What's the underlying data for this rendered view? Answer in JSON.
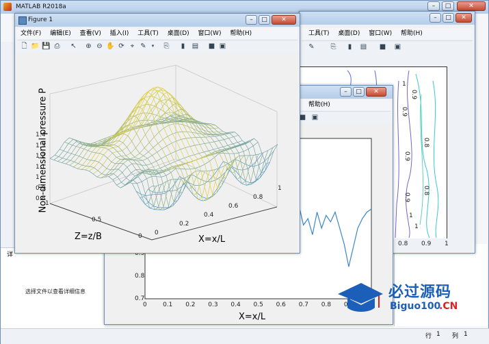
{
  "main_window": {
    "title": "MATLAB R2018a",
    "menu": [
      "文件(F)",
      "编辑(E)",
      "查看(V)",
      "插入(I)",
      "工具(T)",
      "桌面(D)",
      "窗口(W)",
      "帮助(H)"
    ],
    "detail_label": "详",
    "detail_text": "选择文件以查看详细信息",
    "status": {
      "row_label": "行",
      "row_value": "1",
      "col_label": "列",
      "col_value": "1"
    }
  },
  "figure1": {
    "title": "Figure 1",
    "menu": [
      "文件(F)",
      "编辑(E)",
      "查看(V)",
      "插入(I)",
      "工具(T)",
      "桌面(D)",
      "窗口(W)",
      "帮助(H)"
    ],
    "zlabel": "Non-dimensional pressure P",
    "xlabel": "X=x/L",
    "ylabel": "Z=z/B",
    "z_ticks": [
      "1.4",
      "1.3",
      "1.2",
      "1.1",
      "1",
      "0.9",
      "0.8"
    ],
    "x_ticks": [
      "0",
      "0.2",
      "0.4",
      "0.6",
      "0.8",
      "1"
    ],
    "y_ticks": [
      "0",
      "0.5",
      "1"
    ]
  },
  "figure2": {
    "help_menu": "帮助(H)",
    "xlabel": "X=x/L",
    "x_ticks": [
      "0",
      "0.1",
      "0.2",
      "0.3",
      "0.4",
      "0.5",
      "0.6",
      "0.7",
      "0.8",
      "0.9",
      "1"
    ],
    "y_ticks": [
      "0.9",
      "0.8",
      "0.7"
    ]
  },
  "figure3": {
    "menu": [
      "工具(T)",
      "桌面(D)",
      "窗口(W)",
      "帮助(H)"
    ],
    "contour_labels": [
      "1",
      "1",
      "0.9",
      "0.9",
      "0.8",
      "0.9",
      "0.8",
      "0.9",
      "1",
      "1"
    ],
    "x_ticks": [
      "0.8",
      "0.9",
      "1"
    ]
  },
  "watermark": {
    "chinese": "必过源码",
    "latin": "Biguo100",
    "suffix": ".CN"
  },
  "colors": {
    "accent": "#4f94c9",
    "surface_yellow": "#e6d23a",
    "surface_green": "#4fc6a0",
    "surface_blue": "#3d8ed6"
  },
  "chart_data": {
    "type": "line",
    "xlabel": "X=x/L",
    "xlim": [
      0,
      1
    ],
    "ylim": [
      0.7,
      1.2
    ],
    "series": [
      {
        "x": [
          0.6,
          0.62,
          0.64,
          0.66,
          0.68,
          0.7,
          0.72,
          0.74,
          0.76,
          0.78,
          0.8,
          0.82,
          0.84,
          0.86,
          0.88,
          0.9,
          0.92,
          0.94,
          0.96,
          0.98,
          1.0
        ],
        "values": [
          1.02,
          0.98,
          1.0,
          0.96,
          0.99,
          0.93,
          0.95,
          0.9,
          0.97,
          0.92,
          0.96,
          0.94,
          0.97,
          0.92,
          0.87,
          0.8,
          0.86,
          0.92,
          0.95,
          0.97,
          0.98
        ]
      }
    ]
  }
}
